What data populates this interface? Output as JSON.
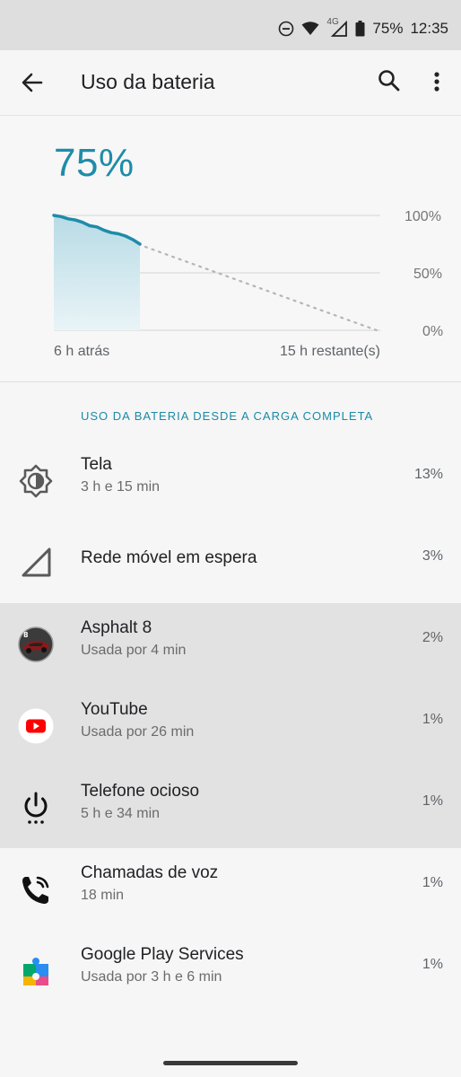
{
  "status_bar": {
    "network": "4G",
    "battery": "75%",
    "time": "12:35"
  },
  "app_bar": {
    "title": "Uso da bateria"
  },
  "summary": {
    "percent": "75%",
    "axis": {
      "y_top": "100%",
      "y_mid": "50%",
      "y_bottom": "0%",
      "x_left": "6 h atrás",
      "x_right": "15 h restante(s)"
    },
    "level_history": [
      100,
      99,
      97,
      96,
      94,
      91,
      90,
      87,
      85,
      84,
      82,
      79,
      75
    ],
    "projection_end": 0,
    "accent": "#1e8ca8"
  },
  "section_title": "USO DA BATERIA DESDE A CARGA COMPLETA",
  "items": [
    {
      "name": "Tela",
      "sub": "3 h e 15 min",
      "pct": "13%",
      "icon": "screen-brightness-icon"
    },
    {
      "name": "Rede móvel em espera",
      "sub": "",
      "pct": "3%",
      "icon": "cell-signal-icon"
    },
    {
      "name": "Asphalt 8",
      "sub": "Usada por 4 min",
      "pct": "2%",
      "icon": "asphalt-app-icon"
    },
    {
      "name": "YouTube",
      "sub": "Usada por 26 min",
      "pct": "1%",
      "icon": "youtube-icon"
    },
    {
      "name": "Telefone ocioso",
      "sub": "5 h e 34 min",
      "pct": "1%",
      "icon": "power-idle-icon"
    },
    {
      "name": "Chamadas de voz",
      "sub": "18 min",
      "pct": "1%",
      "icon": "phone-call-icon"
    },
    {
      "name": "Google Play Services",
      "sub": "Usada por 3 h e 6 min",
      "pct": "1%",
      "icon": "puzzle-piece-icon"
    }
  ]
}
